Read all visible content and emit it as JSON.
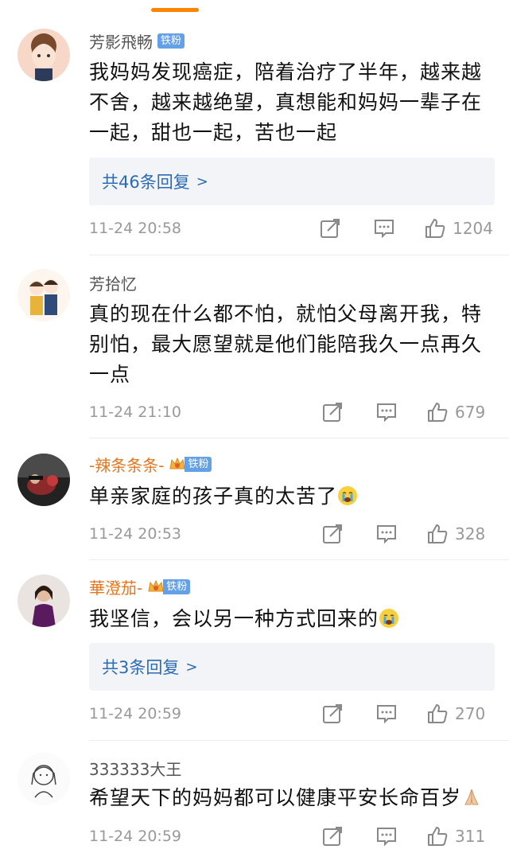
{
  "comments": [
    {
      "username": "芳影飛畅",
      "badge": "铁粉",
      "text": "我妈妈发现癌症，陪着治疗了半年，越来越不舍，越来越绝望，真想能和妈妈一辈子在一起，甜也一起，苦也一起",
      "replies": "共46条回复",
      "time": "11-24 20:58",
      "likes": "1204"
    },
    {
      "username": "芳拾忆",
      "text": "真的现在什么都不怕，就怕父母离开我，特别怕，最大愿望就是他们能陪我久一点再久一点",
      "time": "11-24 21:10",
      "likes": "679"
    },
    {
      "username": "-辣条条条-",
      "badge": "铁粉",
      "text": "单亲家庭的孩子真的太苦了",
      "time": "11-24 20:53",
      "likes": "328"
    },
    {
      "username": "華澄茄-",
      "badge": "铁粉",
      "text": "我坚信，会以另一种方式回来的",
      "replies": "共3条回复",
      "time": "11-24 20:59",
      "likes": "270"
    },
    {
      "username": "333333大王",
      "text": "希望天下的妈妈都可以健康平安长命百岁",
      "time": "11-24 20:59",
      "likes": "311"
    }
  ],
  "colors": {
    "accent": "#ff8200",
    "link": "#2c6bb4",
    "badge": "#63a0e6",
    "vip_name": "#e6761e"
  }
}
